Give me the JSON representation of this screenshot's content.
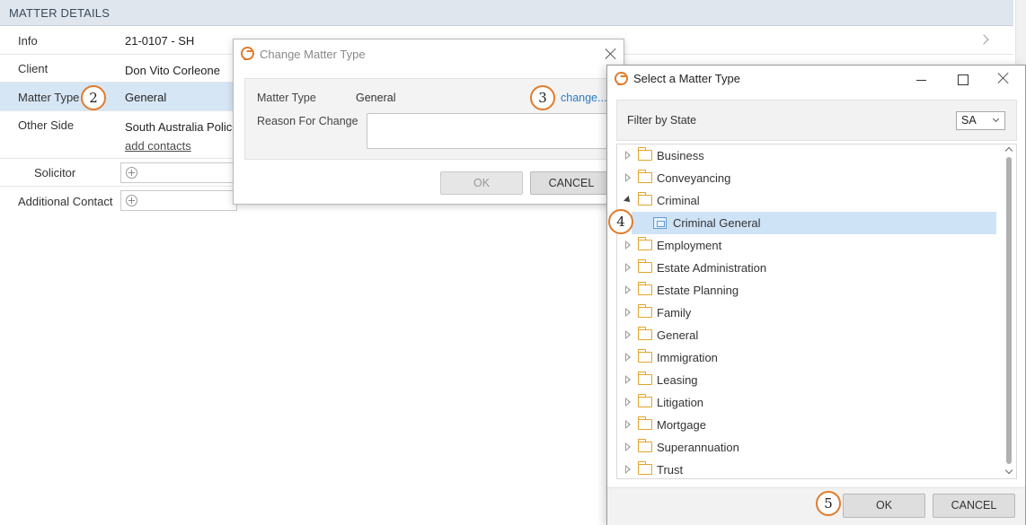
{
  "matter_details": {
    "header": "MATTER DETAILS",
    "rows": [
      {
        "label": "Info",
        "value": "21-0107 - SH"
      },
      {
        "label": "Client",
        "value": "Don Vito Corleone"
      },
      {
        "label": "Matter Type",
        "value": "General"
      },
      {
        "label": "Other Side",
        "value": "South Australia Police",
        "link": "add contacts"
      },
      {
        "label": "Solicitor"
      },
      {
        "label": "Additional Contact"
      }
    ]
  },
  "steps": [
    "2",
    "3",
    "4",
    "5"
  ],
  "change_dialog": {
    "title": "Change Matter Type",
    "matter_type_label": "Matter Type",
    "matter_type_value": "General",
    "change_link": "change...",
    "reason_label": "Reason For Change",
    "reason_value": "",
    "ok_label": "OK",
    "cancel_label": "CANCEL"
  },
  "select_dialog": {
    "title": "Select a Matter Type",
    "filter_label": "Filter by State",
    "state_value": "SA",
    "items": [
      {
        "label": "Business",
        "expanded": false
      },
      {
        "label": "Conveyancing",
        "expanded": false
      },
      {
        "label": "Criminal",
        "expanded": true
      },
      {
        "label": "Criminal General",
        "child": true,
        "selected": true
      },
      {
        "label": "Employment",
        "expanded": false
      },
      {
        "label": "Estate Administration",
        "expanded": false
      },
      {
        "label": "Estate Planning",
        "expanded": false
      },
      {
        "label": "Family",
        "expanded": false
      },
      {
        "label": "General",
        "expanded": false
      },
      {
        "label": "Immigration",
        "expanded": false
      },
      {
        "label": "Leasing",
        "expanded": false
      },
      {
        "label": "Litigation",
        "expanded": false
      },
      {
        "label": "Mortgage",
        "expanded": false
      },
      {
        "label": "Superannuation",
        "expanded": false
      },
      {
        "label": "Trust",
        "expanded": false
      }
    ],
    "ok_label": "OK",
    "cancel_label": "CANCEL"
  },
  "colors": {
    "accent_orange": "#e07b2c",
    "link_blue": "#2a7ac8",
    "selection_blue": "#cfe3f6",
    "header_bg": "#dfe6ee"
  }
}
